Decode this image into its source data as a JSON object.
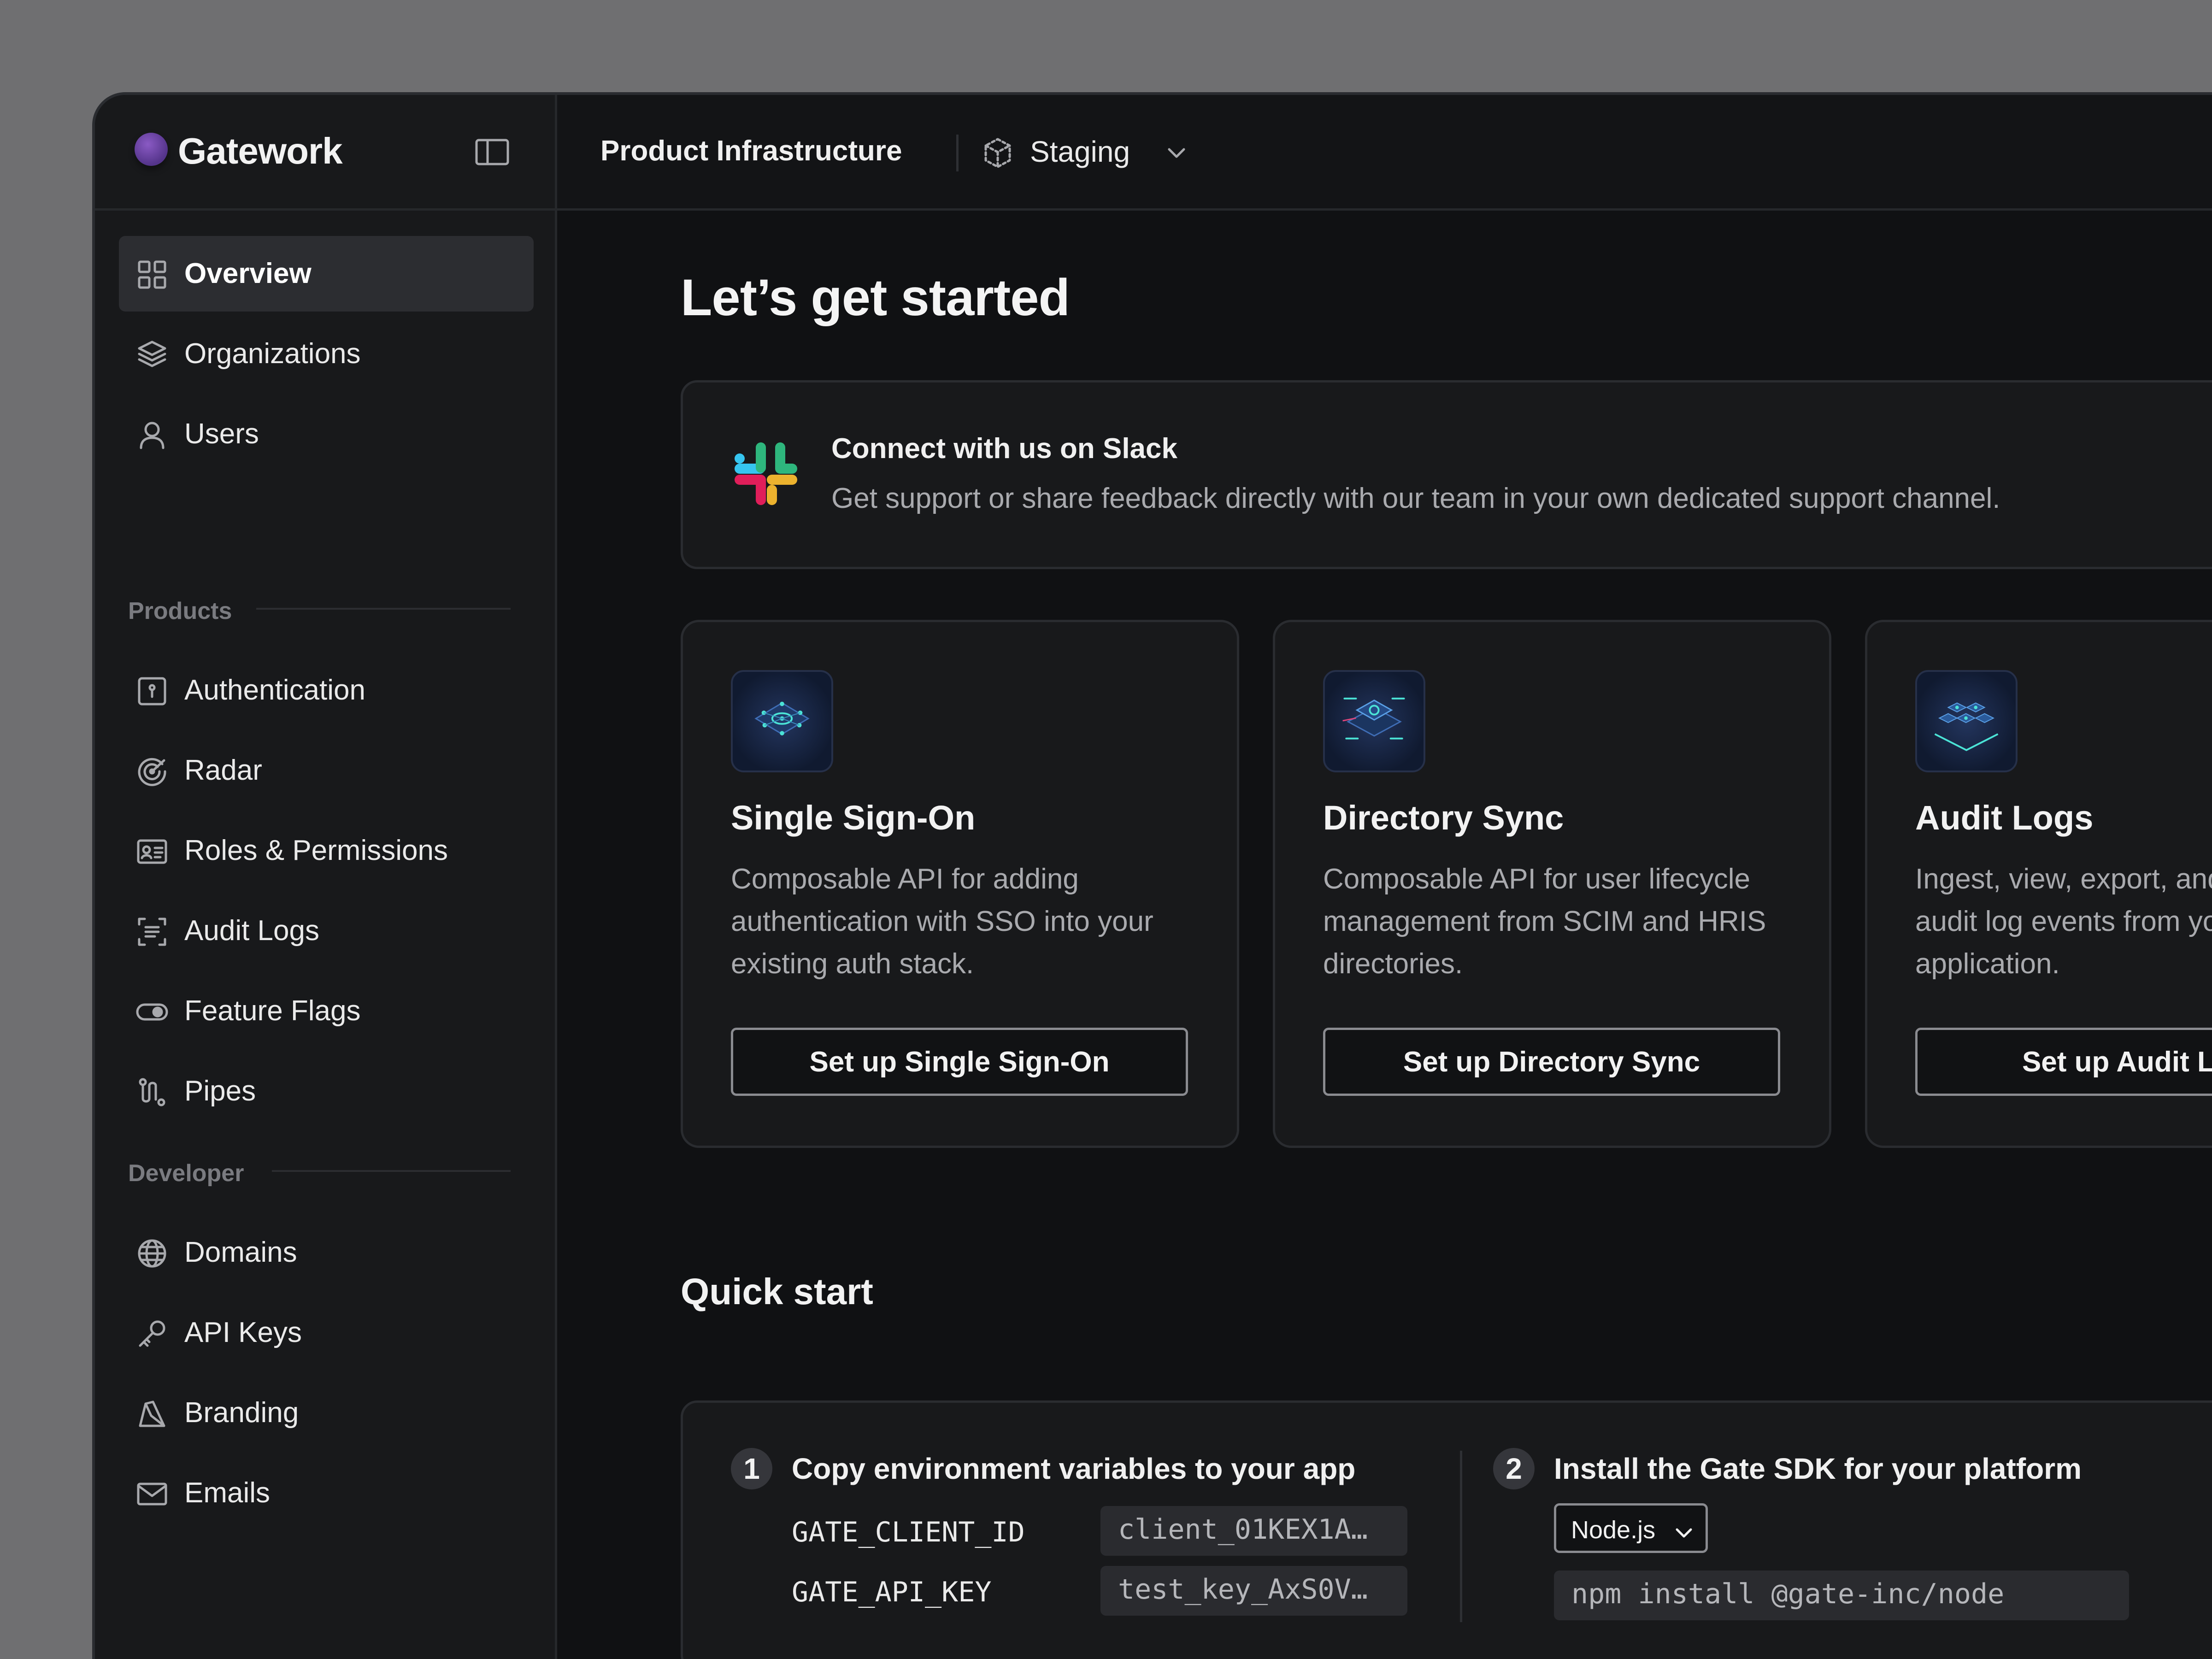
{
  "app": {
    "name": "Gatework",
    "brand_color": "#6b43a8"
  },
  "header": {
    "project": "Product Infrastructure",
    "environment": "Staging"
  },
  "sidebar": {
    "items": [
      {
        "label": "Overview",
        "icon": "grid-icon",
        "active": true
      },
      {
        "label": "Organizations",
        "icon": "layers-icon"
      },
      {
        "label": "Users",
        "icon": "user-icon"
      }
    ],
    "products_label": "Products",
    "products": [
      {
        "label": "Authentication",
        "icon": "auth-icon"
      },
      {
        "label": "Radar",
        "icon": "radar-icon"
      },
      {
        "label": "Roles & Permissions",
        "icon": "id-card-icon"
      },
      {
        "label": "Audit Logs",
        "icon": "scan-icon"
      },
      {
        "label": "Feature Flags",
        "icon": "toggle-icon"
      },
      {
        "label": "Pipes",
        "icon": "pipes-icon"
      }
    ],
    "developer_label": "Developer",
    "developer": [
      {
        "label": "Domains",
        "icon": "globe-icon"
      },
      {
        "label": "API Keys",
        "icon": "key-icon"
      },
      {
        "label": "Branding",
        "icon": "brush-icon"
      },
      {
        "label": "Emails",
        "icon": "mail-icon"
      }
    ]
  },
  "main": {
    "title": "Let’s get started",
    "slack": {
      "title": "Connect with us on Slack",
      "description": "Get support or share feedback directly with our team in your own dedicated support channel."
    },
    "products": [
      {
        "title": "Single Sign-On",
        "description": "Composable API for adding authentication with SSO into your existing auth stack.",
        "button": "Set up Single Sign-On"
      },
      {
        "title": "Directory Sync",
        "description": "Composable API for user lifecycle management from SCIM and HRIS directories.",
        "button": "Set up Directory Sync"
      },
      {
        "title": "Audit Logs",
        "description": "Ingest, view, export, and stream audit log events from your application.",
        "button": "Set up Audit Logs"
      }
    ],
    "quick_start": {
      "title": "Quick start",
      "step1": {
        "number": "1",
        "title": "Copy environment variables to your app",
        "vars": [
          {
            "key": "GATE_CLIENT_ID",
            "value": "client_01KEX1A…"
          },
          {
            "key": "GATE_API_KEY",
            "value": "test_key_AxS0V…"
          }
        ]
      },
      "step2": {
        "number": "2",
        "title": "Install the Gate SDK for your platform",
        "platform": "Node.js",
        "command": "npm install @gate-inc/node"
      }
    }
  }
}
